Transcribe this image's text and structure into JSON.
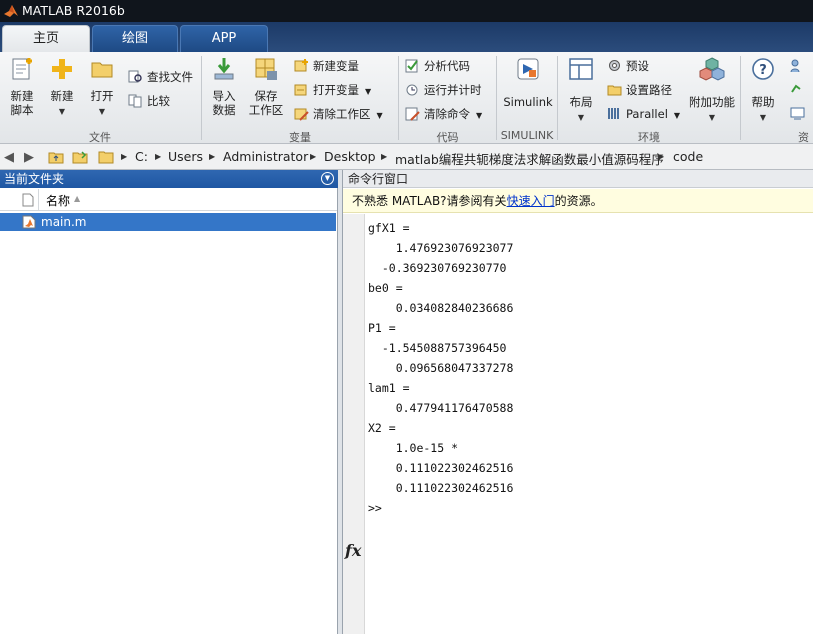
{
  "window": {
    "title": "MATLAB R2016b"
  },
  "tabs": [
    {
      "label": "主页",
      "active": true
    },
    {
      "label": "绘图",
      "active": false
    },
    {
      "label": "APP",
      "active": false
    }
  ],
  "ribbon": {
    "file": {
      "group_label": "文件",
      "new_script": "新建\n脚本",
      "new": "新建",
      "open": "打开",
      "find_files": "查找文件",
      "compare": "比较"
    },
    "variable": {
      "group_label": "变量",
      "import": "导入\n数据",
      "save": "保存\n工作区",
      "new_variable": "新建变量",
      "open_variable": "打开变量",
      "clear_workspace": "清除工作区"
    },
    "code": {
      "group_label": "代码",
      "analyze": "分析代码",
      "run_time": "运行并计时",
      "clear_commands": "清除命令"
    },
    "simulink": {
      "group_label": "SIMULINK",
      "simulink": "Simulink"
    },
    "environment": {
      "group_label": "环境",
      "layout": "布局",
      "preferences": "预设",
      "set_path": "设置路径",
      "parallel": "Parallel",
      "addons": "附加功能"
    },
    "resources": {
      "group_label": "资",
      "help": "帮助"
    }
  },
  "address": {
    "crumbs": [
      "C:",
      "Users",
      "Administrator",
      "Desktop",
      "matlab编程共轭梯度法求解函数最小值源码程序",
      "code"
    ]
  },
  "current_folder": {
    "title": "当前文件夹",
    "column_name": "名称",
    "files": [
      {
        "name": "main.m",
        "selected": true
      }
    ]
  },
  "command_window": {
    "title": "命令行窗口",
    "notice_prefix": "不熟悉 MATLAB?请参阅有关",
    "notice_link": "快速入门",
    "notice_suffix": "的资源。",
    "lines": [
      "gfX1 =",
      "    1.476923076923077",
      "  -0.369230769230770",
      "be0 =",
      "    0.034082840236686",
      "P1 =",
      "  -1.545088757396450",
      "    0.096568047337278",
      "lam1 =",
      "    0.477941176470588",
      "X2 =",
      "    1.0e-15 *",
      "    0.111022302462516",
      "    0.111022302462516"
    ],
    "prompt": ">>",
    "fx_label": "fx"
  },
  "colors": {
    "accent": "#2f67b1",
    "selection": "#3476c8",
    "notice_bg": "#fffde0",
    "link": "#0033cc"
  }
}
